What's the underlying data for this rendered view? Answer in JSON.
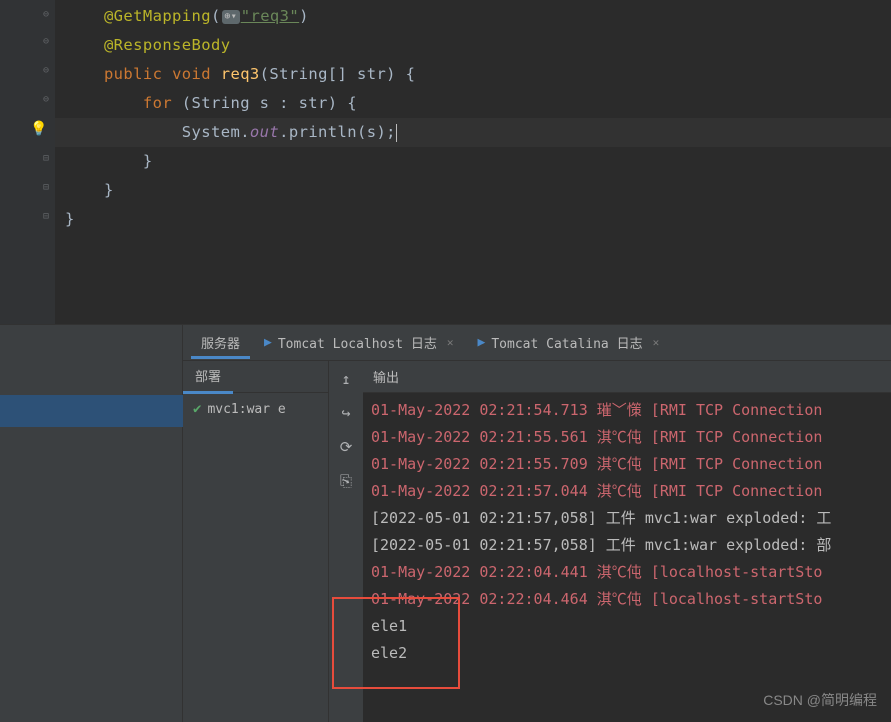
{
  "code": {
    "line1_annotation": "@GetMapping",
    "line1_paren_open": "(",
    "line1_string": "\"req3\"",
    "line1_paren_close": ")",
    "line2_annotation": "@ResponseBody",
    "line3_keyword1": "public ",
    "line3_keyword2": "void ",
    "line3_method": "req3",
    "line3_params": "(String[] str) {",
    "line4_keyword": "for ",
    "line4_rest": "(String s : str) {",
    "line5_class": "System.",
    "line5_field": "out",
    "line5_dot": ".",
    "line5_method": "println",
    "line5_args": "(s);",
    "line6_brace": "}",
    "line7_brace": "}",
    "line8_brace": "}"
  },
  "tabs": {
    "server": "服务器",
    "localhost": "Tomcat Localhost 日志",
    "catalina": "Tomcat Catalina 日志"
  },
  "deploy": {
    "subtab": "部署",
    "item": "mvc1:war e"
  },
  "output": {
    "header": "输出"
  },
  "console": {
    "lines": [
      {
        "cls": "log-red",
        "text": "01-May-2022 02:21:54.713 璀﹀憡 [RMI TCP Connection"
      },
      {
        "cls": "log-red",
        "text": "01-May-2022 02:21:55.561 淇℃伅 [RMI TCP Connection"
      },
      {
        "cls": "log-red",
        "text": "01-May-2022 02:21:55.709 淇℃伅 [RMI TCP Connection"
      },
      {
        "cls": "log-red",
        "text": "01-May-2022 02:21:57.044 淇℃伅 [RMI TCP Connection"
      },
      {
        "cls": "log-white",
        "text": "[2022-05-01 02:21:57,058] 工件 mvc1:war exploded: 工"
      },
      {
        "cls": "log-white",
        "text": "[2022-05-01 02:21:57,058] 工件 mvc1:war exploded: 部"
      },
      {
        "cls": "log-red",
        "text": "01-May-2022 02:22:04.441 淇℃伅 [localhost-startSto"
      },
      {
        "cls": "log-red",
        "text": "01-May-2022 02:22:04.464 淇℃伅 [localhost-startSto"
      },
      {
        "cls": "log-white",
        "text": "ele1"
      },
      {
        "cls": "log-white",
        "text": "ele2"
      }
    ]
  },
  "watermark": "CSDN @简明编程"
}
